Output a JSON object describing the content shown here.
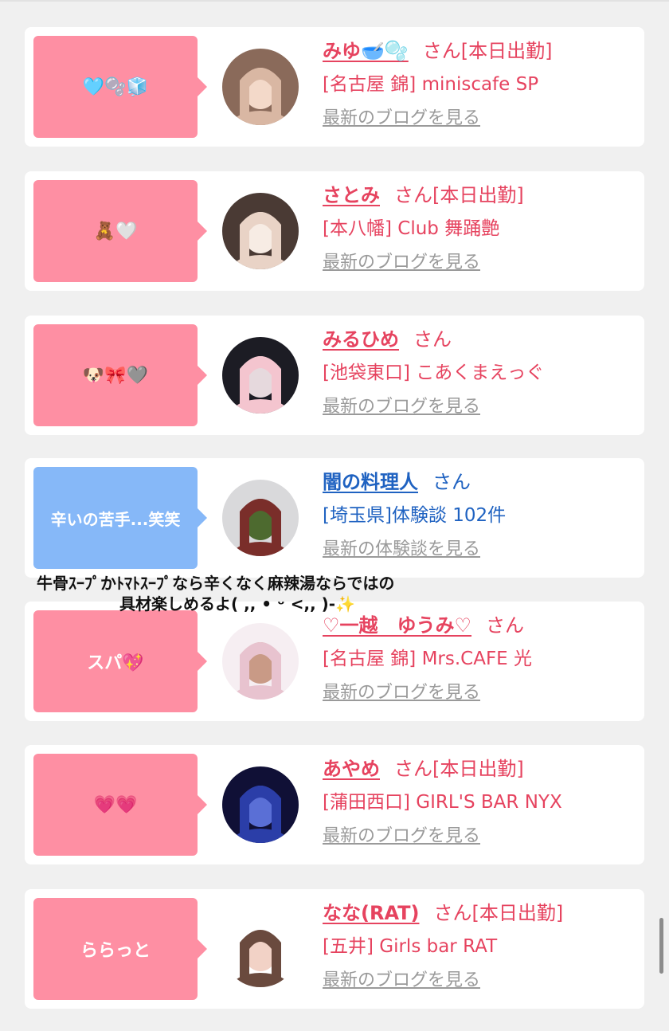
{
  "cards": [
    {
      "bubble_text": "🩵🫧🧊",
      "bubble_color": "pink",
      "name": "みゆ🥣🫧",
      "san": "さん",
      "status": "[本日出勤]",
      "shop": "[名古屋 錦] miniscafe SP",
      "link": "最新のブログを見る",
      "theme": "pink",
      "avatar_colors": [
        "#8a6a5a",
        "#d9b7a3",
        "#f3d9c9"
      ]
    },
    {
      "bubble_text": "🧸🤍",
      "bubble_color": "pink",
      "name": "さとみ",
      "san": "さん",
      "status": "[本日出勤]",
      "shop": "[本八幡] Club 舞踊艶",
      "link": "最新のブログを見る",
      "theme": "pink",
      "avatar_colors": [
        "#4a3a34",
        "#e9d3c6",
        "#f7ece4"
      ]
    },
    {
      "bubble_text": "🐶🎀🩶",
      "bubble_color": "pink",
      "name": "みるひめ",
      "san": "さん",
      "status": "",
      "shop": "[池袋東口] こあくまえっぐ",
      "link": "最新のブログを見る",
      "theme": "pink",
      "avatar_colors": [
        "#1c1c24",
        "#f4c5cf",
        "#e6d9dd"
      ]
    },
    {
      "bubble_text": "辛いの苦手...笑笑",
      "bubble_color": "blue",
      "name": "闇の料理人",
      "san": "さん",
      "status": "",
      "shop": "[埼玉県]体験談 102件",
      "link": "最新の体験談を見る",
      "theme": "blue",
      "avatar_colors": [
        "#d9d9db",
        "#7a2e2a",
        "#4d6a2f"
      ]
    },
    {
      "bubble_text": "スパ💖",
      "bubble_color": "pink",
      "name": "♡一越　ゆうみ♡",
      "san": "さん",
      "status": "",
      "shop": "[名古屋 錦] Mrs.CAFE 光",
      "link": "最新のブログを見る",
      "theme": "pink",
      "avatar_colors": [
        "#f6eef2",
        "#e8c3cf",
        "#c99a86"
      ]
    },
    {
      "bubble_text": "💗💗",
      "bubble_color": "pink",
      "name": "あやめ",
      "san": "さん",
      "status": "[本日出勤]",
      "shop": "[蒲田西口] GIRL'S BAR NYX",
      "link": "最新のブログを見る",
      "theme": "pink",
      "avatar_colors": [
        "#101036",
        "#2b3ea8",
        "#5a6fd6"
      ]
    },
    {
      "bubble_text": "ららっと",
      "bubble_color": "pink",
      "name": "なな(RAT)",
      "san": "さん",
      "status": "[本日出勤]",
      "shop": "[五井] Girls bar RAT",
      "link": "最新のブログを見る",
      "theme": "pink",
      "avatar_colors": [
        "#ffffff",
        "#6a4a3e",
        "#f2d2c6"
      ]
    }
  ],
  "overlay": {
    "line1": "牛骨ｽｰﾌﾟかﾄﾏﾄｽｰﾌﾟなら辛くなく麻辣湯ならではの",
    "line2": "具材楽しめるよ( ,, • ᵕ <,, )-✨"
  }
}
